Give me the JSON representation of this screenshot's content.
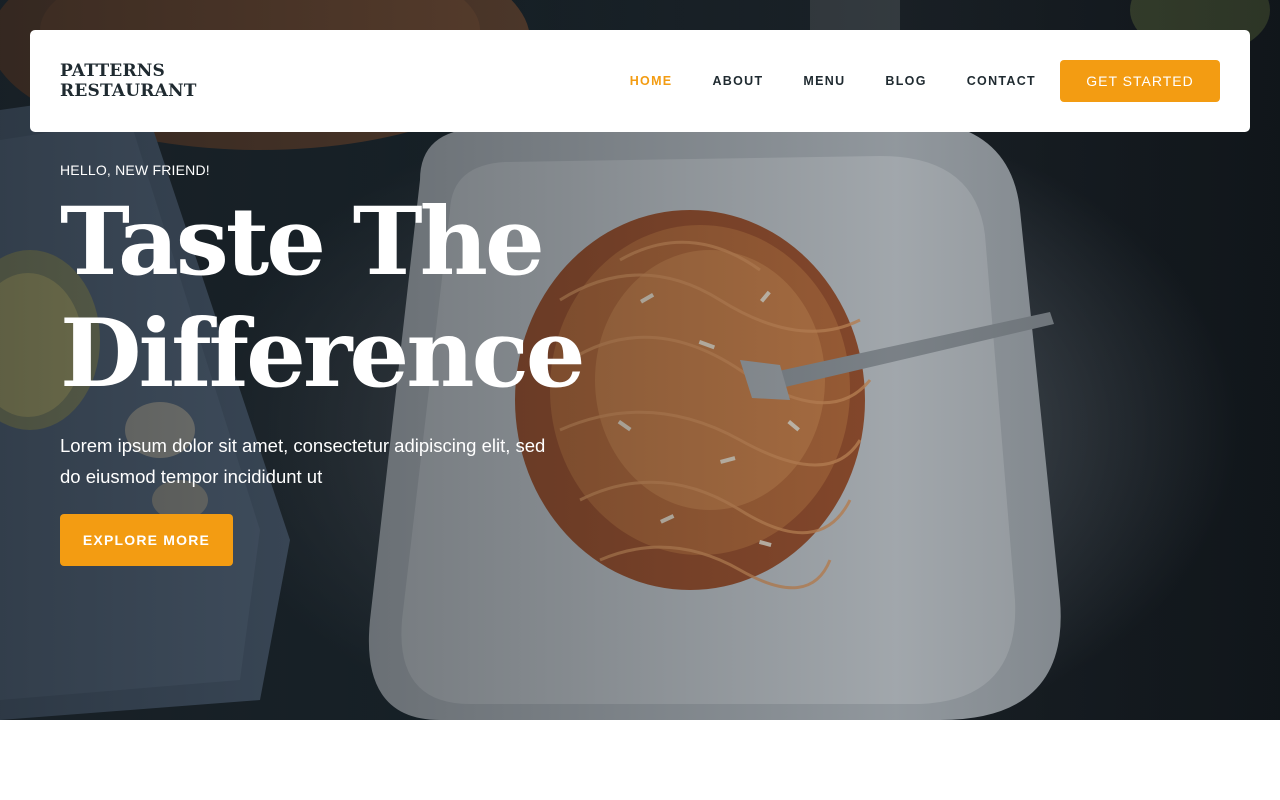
{
  "brand": {
    "name_line1": "PATTERNS",
    "name_line2": "RESTAURANT"
  },
  "nav": {
    "items": [
      {
        "label": "HOME",
        "active": true
      },
      {
        "label": "ABOUT",
        "active": false
      },
      {
        "label": "MENU",
        "active": false
      },
      {
        "label": "BLOG",
        "active": false
      },
      {
        "label": "CONTACT",
        "active": false
      }
    ],
    "cta_label": "GET STARTED"
  },
  "hero": {
    "eyebrow": "HELLO, NEW FRIEND!",
    "headline_line1": "Taste The",
    "headline_line2": "Difference",
    "description": "Lorem ipsum dolor sit amet, consectetur adipiscing elit, sed do eiusmod tempor incididunt ut",
    "button_label": "EXPLORE MORE",
    "image_subject": "spaghetti-on-plate-photo"
  },
  "colors": {
    "accent": "#f39c12",
    "dark_text": "#1f2a30",
    "white": "#ffffff"
  }
}
